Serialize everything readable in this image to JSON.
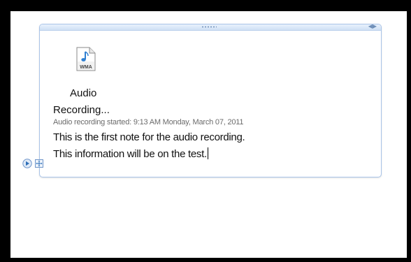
{
  "note": {
    "audio_title": "Audio",
    "audio_subtitle": "Recording...",
    "audio_meta": "Audio recording started: 9:13 AM Monday, March 07, 2011",
    "lines": [
      "This is the first note for the audio recording.",
      "This information will be on the test."
    ],
    "icon_label": "WMA"
  },
  "icons": {
    "audio_file": "audio-file-icon",
    "expand_arrow": "play-arrow-icon",
    "move_handle": "move-handle-icon",
    "resize": "resize-icon",
    "grip": "grip-icon"
  },
  "colors": {
    "outer_border": "#000000",
    "canvas": "#ffffff",
    "container_border": "#a9c4e8",
    "header_bar": "#cfe0f5",
    "meta_text": "#6b6b6b",
    "text": "#111111",
    "accent": "#2f7fd1"
  }
}
